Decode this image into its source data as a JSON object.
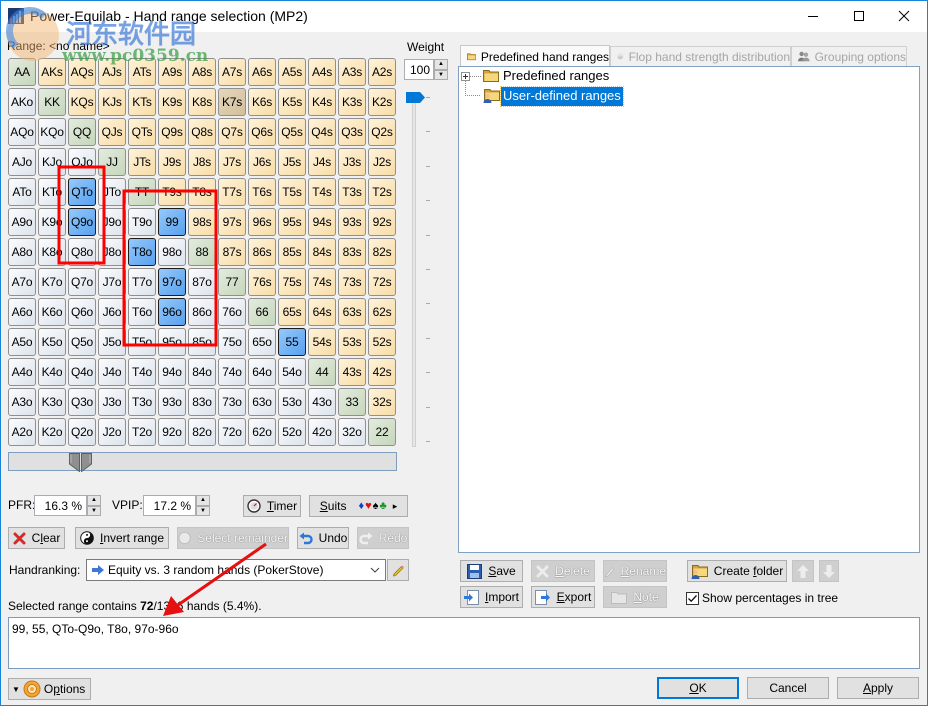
{
  "window": {
    "title": "Power-Equilab - Hand range selection (MP2)"
  },
  "watermark": {
    "site_name": "河东软件园",
    "url": "www.pc0359.cn"
  },
  "range_header": {
    "label": "Range:",
    "name": "<no name>"
  },
  "weight": {
    "label": "Weight",
    "value": "100",
    "slider_percent": 100
  },
  "grid": {
    "rows": [
      [
        "AA",
        "AKs",
        "AQs",
        "AJs",
        "ATs",
        "A9s",
        "A8s",
        "A7s",
        "A6s",
        "A5s",
        "A4s",
        "A3s",
        "A2s"
      ],
      [
        "AKo",
        "KK",
        "KQs",
        "KJs",
        "KTs",
        "K9s",
        "K8s",
        "K7s",
        "K6s",
        "K5s",
        "K4s",
        "K3s",
        "K2s"
      ],
      [
        "AQo",
        "KQo",
        "QQ",
        "QJs",
        "QTs",
        "Q9s",
        "Q8s",
        "Q7s",
        "Q6s",
        "Q5s",
        "Q4s",
        "Q3s",
        "Q2s"
      ],
      [
        "AJo",
        "KJo",
        "QJo",
        "JJ",
        "JTs",
        "J9s",
        "J8s",
        "J7s",
        "J6s",
        "J5s",
        "J4s",
        "J3s",
        "J2s"
      ],
      [
        "ATo",
        "KTo",
        "QTo",
        "JTo",
        "TT",
        "T9s",
        "T8s",
        "T7s",
        "T6s",
        "T5s",
        "T4s",
        "T3s",
        "T2s"
      ],
      [
        "A9o",
        "K9o",
        "Q9o",
        "J9o",
        "T9o",
        "99",
        "98s",
        "97s",
        "96s",
        "95s",
        "94s",
        "93s",
        "92s"
      ],
      [
        "A8o",
        "K8o",
        "Q8o",
        "J8o",
        "T8o",
        "98o",
        "88",
        "87s",
        "86s",
        "85s",
        "84s",
        "83s",
        "82s"
      ],
      [
        "A7o",
        "K7o",
        "Q7o",
        "J7o",
        "T7o",
        "97o",
        "87o",
        "77",
        "76s",
        "75s",
        "74s",
        "73s",
        "72s"
      ],
      [
        "A6o",
        "K6o",
        "Q6o",
        "J6o",
        "T6o",
        "96o",
        "86o",
        "76o",
        "66",
        "65s",
        "64s",
        "63s",
        "62s"
      ],
      [
        "A5o",
        "K5o",
        "Q5o",
        "J5o",
        "T5o",
        "95o",
        "85o",
        "75o",
        "65o",
        "55",
        "54s",
        "53s",
        "52s"
      ],
      [
        "A4o",
        "K4o",
        "Q4o",
        "J4o",
        "T4o",
        "94o",
        "84o",
        "74o",
        "64o",
        "54o",
        "44",
        "43s",
        "42s"
      ],
      [
        "A3o",
        "K3o",
        "Q3o",
        "J3o",
        "T3o",
        "93o",
        "83o",
        "73o",
        "63o",
        "53o",
        "43o",
        "33",
        "32s"
      ],
      [
        "A2o",
        "K2o",
        "Q2o",
        "J2o",
        "T2o",
        "92o",
        "82o",
        "72o",
        "62o",
        "52o",
        "42o",
        "32o",
        "22"
      ]
    ],
    "selected": [
      "99",
      "55",
      "QTo",
      "Q9o",
      "T8o",
      "97o",
      "96o"
    ],
    "hovered": "K7s"
  },
  "hand_percent_slider": {
    "pfr_percent": 16.3,
    "vpip_percent": 17.2
  },
  "stats": {
    "pfr_label": "PFR:",
    "pfr_value": "16.3 %",
    "vpip_label": "VPIP:",
    "vpip_value": "17.2 %"
  },
  "actions": {
    "timer": {
      "label": "Timer",
      "accel": 0
    },
    "suits": {
      "label": "Suits",
      "accel": 0,
      "symbols": [
        "♦",
        "♥",
        "♠",
        "♣"
      ],
      "more": "▸"
    },
    "clear": {
      "label": "Clear",
      "accel": 1
    },
    "invert": {
      "label": "Invert range",
      "accel": 0
    },
    "select_remainder": {
      "label": "Select remainder",
      "enabled": false
    },
    "undo": {
      "label": "Undo"
    },
    "redo": {
      "label": "Redo",
      "enabled": false
    }
  },
  "handranking": {
    "label": "Handranking:",
    "value": "Equity vs. 3 random hands (PokerStove)"
  },
  "summary": {
    "prefix": "Selected range contains ",
    "selected": "72",
    "suffix": "/1326 hands (5.4%)."
  },
  "range_text": "99, 55, QTo-Q9o, T8o, 97o-96o",
  "tabs": [
    {
      "label": "Predefined hand ranges",
      "active": true
    },
    {
      "label": "Flop hand strength distribution",
      "enabled": false
    },
    {
      "label": "Grouping options",
      "enabled": false
    }
  ],
  "tree": [
    {
      "label": "Predefined ranges",
      "expandable": true,
      "selected": false
    },
    {
      "label": "User-defined ranges",
      "selected": true
    }
  ],
  "tree_actions": {
    "save": {
      "label": "Save",
      "accel": 0
    },
    "delete": {
      "label": "Delete",
      "accel": 0,
      "enabled": false
    },
    "rename": {
      "label": "Rename",
      "accel": 0,
      "enabled": false
    },
    "create_folder": {
      "label": "Create folder",
      "accel": 7
    },
    "import": {
      "label": "Import",
      "accel": 0
    },
    "export": {
      "label": "Export",
      "accel": 0
    },
    "note": {
      "label": "Note",
      "accel": 0,
      "enabled": false
    }
  },
  "show_percentages": {
    "label": "Show percentages in tree",
    "checked": true
  },
  "footer": {
    "options": {
      "label": "Options",
      "accel": 1
    },
    "ok": {
      "label": "OK",
      "accel": 0
    },
    "cancel": {
      "label": "Cancel"
    },
    "apply": {
      "label": "Apply",
      "accel": 0
    }
  },
  "colors": {
    "selected_cell": "#6aaef5",
    "suited_cell": "#fbe3b6",
    "pair_cell": "#d0dec8",
    "offsuit_cell": "#eef1f5",
    "annotation": "#ff0000",
    "accent": "#0078d7"
  }
}
